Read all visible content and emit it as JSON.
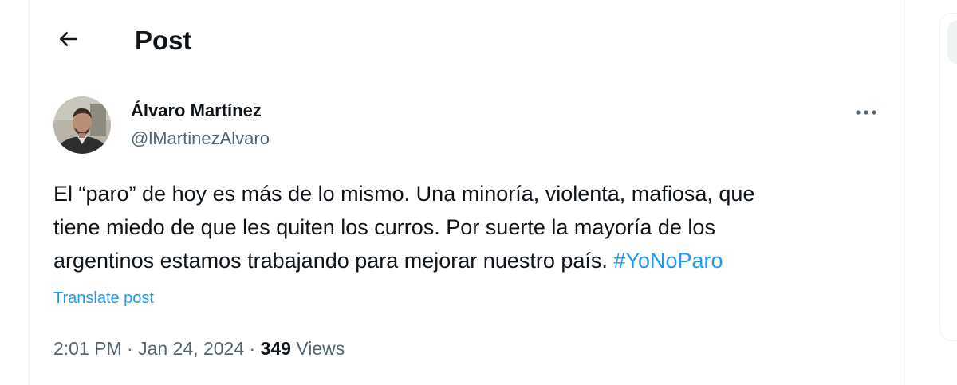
{
  "header": {
    "title": "Post",
    "back_icon": "arrow-left-icon"
  },
  "author": {
    "name": "Álvaro Martínez",
    "handle": "@lMartinezAlvaro",
    "avatar_icon": "user-avatar"
  },
  "tweet": {
    "lines": [
      "El “paro” de hoy es más de lo mismo. Una minoría, violenta, mafiosa, que",
      "tiene miedo de que les quiten los curros. Por suerte la mayoría de los",
      "argentinos estamos trabajando para mejorar nuestro país. "
    ],
    "hashtag": "#YoNoParo",
    "translate_label": "Translate post",
    "more_icon": "more-horizontal-icon"
  },
  "meta": {
    "time": "2:01 PM",
    "separator": "·",
    "date": "Jan 24, 2024",
    "view_count": "349",
    "views_label": "Views"
  },
  "colors": {
    "link": "#1d9bf0",
    "secondary_text": "#536471",
    "primary_text": "#0f1419",
    "border": "#eff3f4"
  }
}
